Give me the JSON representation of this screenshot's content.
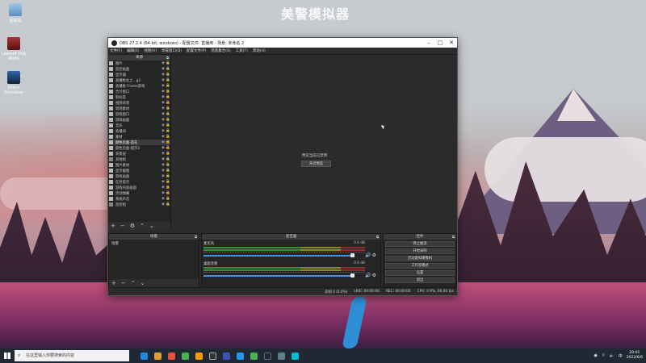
{
  "wallpaper": {
    "title": "美警模拟器"
  },
  "desktop_icons": [
    {
      "label": "回收站"
    },
    {
      "label": "Lawsuit Hub Mafia"
    },
    {
      "label": "Police Simulator"
    }
  ],
  "obs": {
    "title": "OBS 27.2.4 (64-bit, windows) - 配置文件: 直播用 - 场景: 未命名 2",
    "menu": [
      "文件(F)",
      "编辑(E)",
      "视图(V)",
      "停靠窗口(D)",
      "配置文件(P)",
      "场景集合(S)",
      "工具(T)",
      "帮助(H)"
    ],
    "sources_header": "来源",
    "sources": [
      {
        "name": "图片",
        "icon": "image"
      },
      {
        "name": "监控画面",
        "icon": "image"
      },
      {
        "name": "显示器",
        "icon": "monitor"
      },
      {
        "name": "直播框右上…g1",
        "icon": "image"
      },
      {
        "name": "直播框 Frame游戏",
        "icon": "image"
      },
      {
        "name": "合计窗口",
        "icon": "image"
      },
      {
        "name": "新标签",
        "icon": "image"
      },
      {
        "name": "视频背景",
        "icon": "image"
      },
      {
        "name": "转场素材",
        "icon": "image"
      },
      {
        "name": "游戏窗口",
        "icon": "image"
      },
      {
        "name": "游戏画面",
        "icon": "image"
      },
      {
        "name": "音乐",
        "icon": "image"
      },
      {
        "name": "直播间",
        "icon": "image"
      },
      {
        "name": "素材",
        "icon": "image"
      },
      {
        "name": "颜色页面-首先",
        "icon": "text"
      },
      {
        "name": "颜色页面-提示2",
        "icon": "text"
      },
      {
        "name": "背景层",
        "icon": "image"
      },
      {
        "name": "其他组",
        "icon": "group"
      },
      {
        "name": "图片素材",
        "icon": "image"
      },
      {
        "name": "显示截图",
        "icon": "image"
      },
      {
        "name": "游戏画面",
        "icon": "image"
      },
      {
        "name": "任务提示",
        "icon": "image"
      },
      {
        "name": "游戏内容画面",
        "icon": "image"
      },
      {
        "name": "活动弹幕",
        "icon": "image"
      },
      {
        "name": "系统声音",
        "icon": "image"
      },
      {
        "name": "监控组",
        "icon": "group"
      }
    ],
    "preview_message": "预览当前已禁用",
    "preview_button": "开启预览",
    "scenes_header": "场景",
    "scenes": [
      "场景"
    ],
    "mixer_header": "混音器",
    "mixer": [
      {
        "name": "麦克风",
        "db": "0.0 dB"
      },
      {
        "name": "桌面音频",
        "db": "0.0 dB"
      }
    ],
    "controls_header": "控件",
    "controls": [
      "停止推流",
      "开始录制",
      "启动虚拟摄像机",
      "工作室模式",
      "设置",
      "退出"
    ],
    "status": {
      "dropped": "丢帧 0 (0.0%)",
      "live": "LIVE: 00:00:00",
      "rec": "REC: 00:00:00",
      "cpu": "CPU: 0.9%, 60.00 fps"
    }
  },
  "taskbar": {
    "search_placeholder": "在这里输入你要搜索的内容",
    "time": "20:01",
    "date": "2022/6/6"
  }
}
